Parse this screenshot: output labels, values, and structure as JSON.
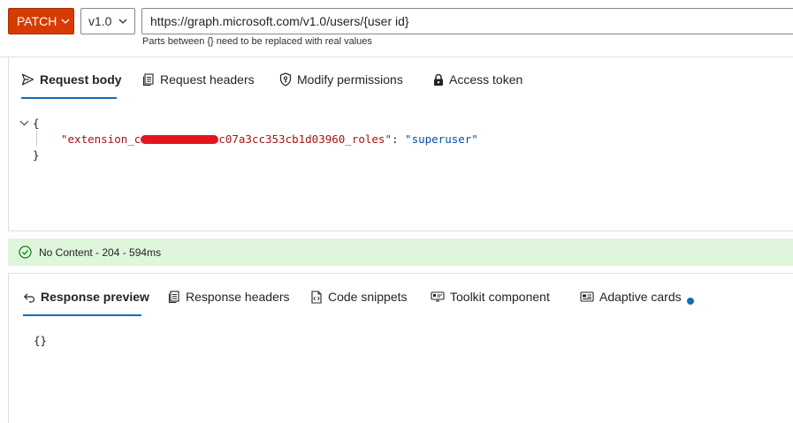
{
  "request": {
    "method": "PATCH",
    "version": "v1.0",
    "url": "https://graph.microsoft.com/v1.0/users/{user id}",
    "hint": "Parts between {} need to be replaced with real values"
  },
  "request_tabs": [
    {
      "label": "Request body",
      "icon": "send-icon",
      "active": true
    },
    {
      "label": "Request headers",
      "icon": "document-icon"
    },
    {
      "label": "Modify permissions",
      "icon": "shield-key-icon"
    },
    {
      "label": "Access token",
      "icon": "lock-icon"
    }
  ],
  "request_body": {
    "open_brace": "{",
    "key_prefix": "\"extension_c",
    "key_suffix": "c07a3cc353cb1d03960_roles\"",
    "separator": ": ",
    "value": "\"superuser\"",
    "close_brace": "}"
  },
  "status": {
    "text": "No Content - 204 - 594ms",
    "color": "#dff6dd"
  },
  "response_tabs": [
    {
      "label": "Response preview",
      "icon": "undo-arrow-icon",
      "active": true
    },
    {
      "label": "Response headers",
      "icon": "document-icon"
    },
    {
      "label": "Code snippets",
      "icon": "code-document-icon"
    },
    {
      "label": "Toolkit component",
      "icon": "toolkit-icon"
    },
    {
      "label": "Adaptive cards",
      "icon": "card-icon",
      "badge": "dot"
    }
  ],
  "response_body": "{}",
  "colors": {
    "accent": "#0f6cbd",
    "method": "#d83b01"
  }
}
